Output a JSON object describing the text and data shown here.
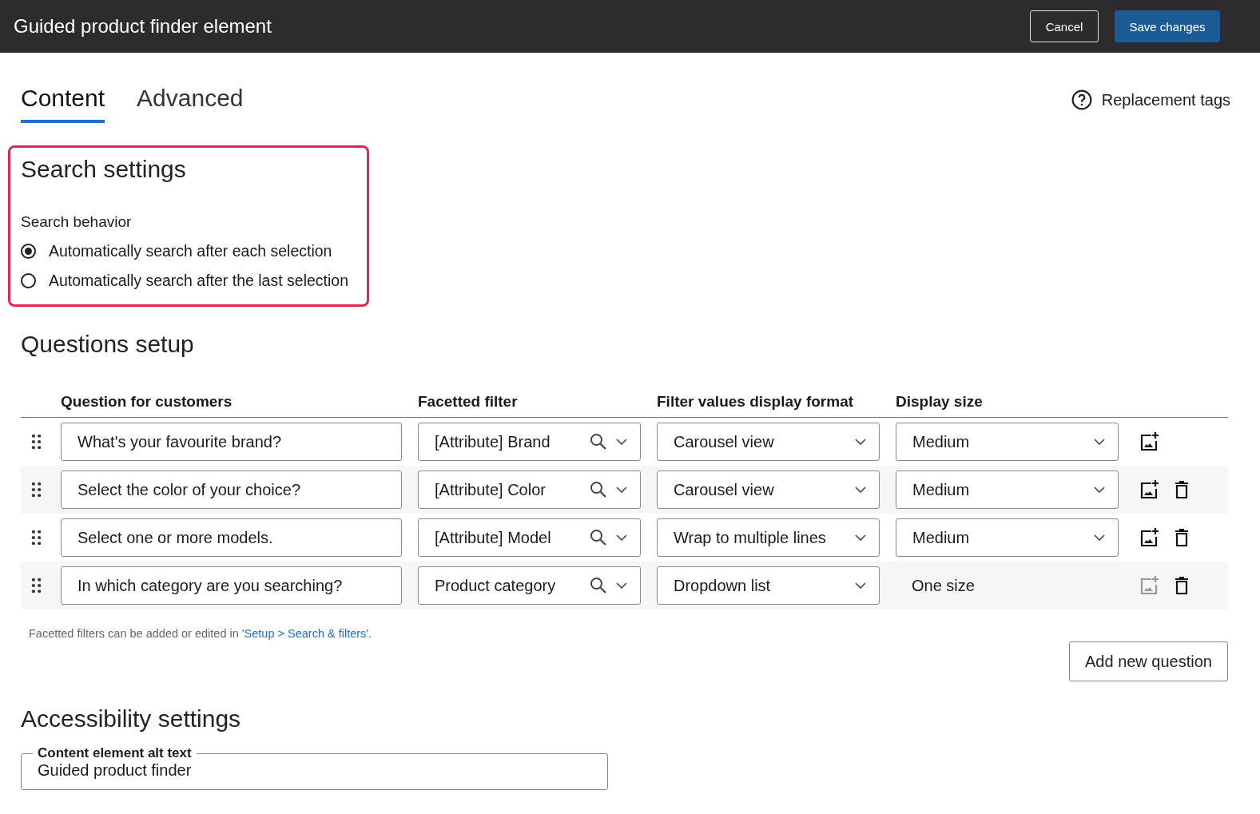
{
  "header": {
    "title": "Guided product finder element",
    "buttons": [
      {
        "label": "Cancel",
        "kind": "secondary"
      },
      {
        "label": "Save changes",
        "kind": "primary"
      }
    ]
  },
  "tabs": [
    {
      "label": "Content",
      "selected": true
    },
    {
      "label": "Advanced",
      "selected": false
    }
  ],
  "help_link": "Replacement tags",
  "search_settings": {
    "title": "Search settings",
    "label": "Search behavior",
    "options": [
      {
        "label": "Automatically search after each selection",
        "selected": true
      },
      {
        "label": "Automatically search after the last selection",
        "selected": false
      }
    ]
  },
  "questions": {
    "title": "Questions setup",
    "columns": [
      "Question for customers",
      "Facetted filter",
      "Filter values display format",
      "Display size"
    ],
    "rows": [
      {
        "question": "What's your favourite brand?",
        "filter": "[Attribute] Brand",
        "format": "Carousel view",
        "size": "Medium",
        "kind": "select",
        "image_disabled": false,
        "deletable": false
      },
      {
        "question": "Select the color of your choice?",
        "filter": "[Attribute] Color",
        "format": "Carousel view",
        "size": "Medium",
        "kind": "select",
        "image_disabled": false,
        "deletable": true
      },
      {
        "question": "Select one or more models.",
        "filter": "[Attribute] Model",
        "format": "Wrap to multiple lines",
        "size": "Medium",
        "kind": "select",
        "image_disabled": false,
        "deletable": true
      },
      {
        "question": "In which category are you searching?",
        "filter": "Product category",
        "format": "Dropdown list",
        "size": "One size",
        "kind": "text",
        "image_disabled": true,
        "deletable": true
      }
    ],
    "note": "Facetted filters can be added or edited in ",
    "note_link": "'Setup > Search & filters'",
    "note_end": ".",
    "add_button": "Add new question"
  },
  "accessibility": {
    "title": "Accessibility settings",
    "field_label": "Content element alt text",
    "field_value": "Guided product finder"
  }
}
